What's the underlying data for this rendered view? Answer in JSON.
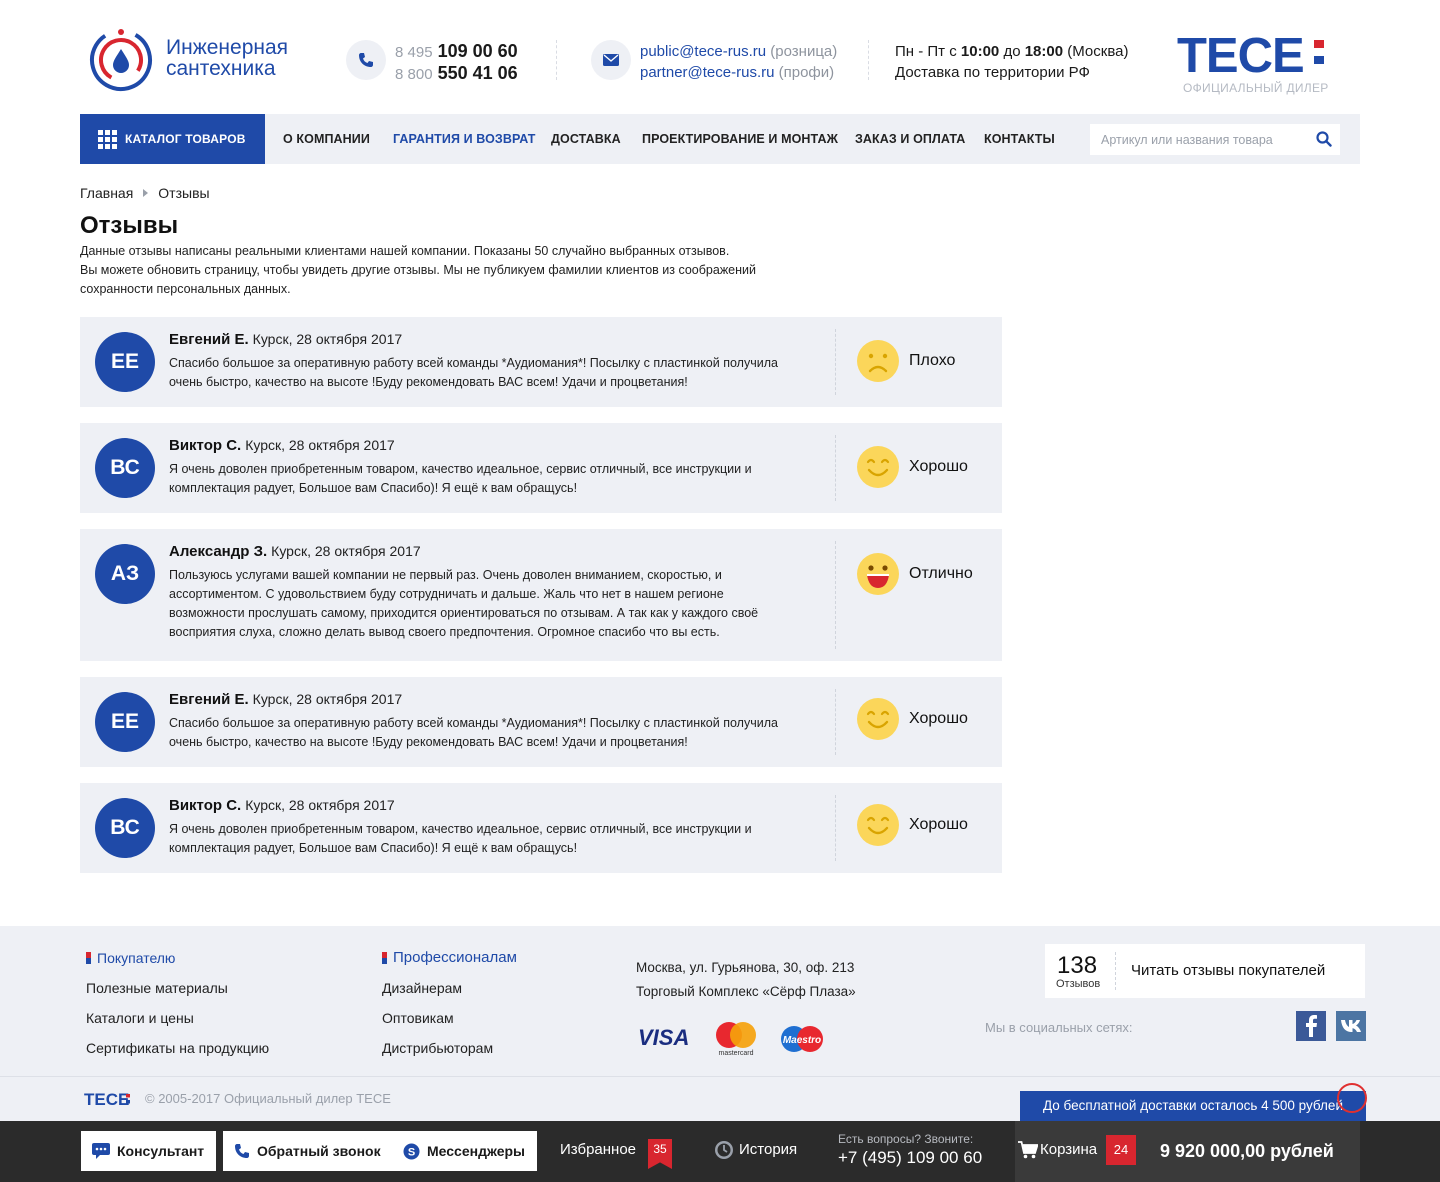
{
  "header": {
    "logo_line1": "Инженерная",
    "logo_line2": "сантехника",
    "phones": [
      {
        "prefix": "8 495",
        "number": "109 00 60"
      },
      {
        "prefix": "8 800",
        "number": "550 41 06"
      }
    ],
    "emails": [
      {
        "address": "public@tece-rus.ru",
        "note": "(розница)"
      },
      {
        "address": "partner@tece-rus.ru",
        "note": "(профи)"
      }
    ],
    "hours": {
      "days": "Пн - Пт с",
      "from": "10:00",
      "to_word": "до",
      "to": "18:00",
      "city": "(Москва)"
    },
    "delivery_area": "Доставка по территории РФ",
    "brand": "TECE",
    "brand_sub": "ОФИЦИАЛЬНЫЙ ДИЛЕР",
    "brand_color": "#1f4aa8",
    "accent_red": "#d8262f"
  },
  "nav": {
    "catalog_label": "КАТАЛОГ ТОВАРОВ",
    "items": [
      "О КОМПАНИИ",
      "ГАРАНТИЯ И ВОЗВРАТ",
      "ДОСТАВКА",
      "ПРОЕКТИРОВАНИЕ И МОНТАЖ",
      "ЗАКАЗ И ОПЛАТА",
      "КОНТАКТЫ"
    ],
    "active_item": "ГАРАНТИЯ И ВОЗВРАТ",
    "search_placeholder": "Артикул или названия товара",
    "search_value": ""
  },
  "breadcrumb": [
    "Главная",
    "Отзывы"
  ],
  "page": {
    "title": "Отзывы",
    "intro_line1": "Данные отзывы написаны реальными клиентами нашей компании. Показаны 50 случайно выбранных отзывов.",
    "intro_line2": "Вы можете обновить страницу, чтобы увидеть другие отзывы. Мы не публикуем фамилии клиентов из соображений сохранности персональных данных."
  },
  "reviews": [
    {
      "initials": "ЕЕ",
      "name": "Евгений Е.",
      "meta": "Курск, 28 октября 2017",
      "text": "Спасибо большое за оперативную работу всей команды *Аудиомания*! Посылку с пластинкой получила очень быстро, качество на высоте !Буду рекомендовать ВАС всем! Удачи и процветания!",
      "rating": "Плохо",
      "mood": "sad-face-icon"
    },
    {
      "initials": "ВС",
      "name": "Виктор С.",
      "meta": "Курск, 28 октября 2017",
      "text": "Я очень доволен приобретенным товаром, качество идеальное, сервис отличный, все инструкции и комплектация радует, Большое вам Спасибо)! Я ещё к вам обращусь!",
      "rating": "Хорошо",
      "mood": "smile-face-icon"
    },
    {
      "initials": "АЗ",
      "name": "Александр З.",
      "meta": "Курск, 28 октября 2017",
      "text": "Пользуюсь услугами вашей компании не первый раз. Очень доволен вниманием, скоростью, и ассортиментом. С удовольствием буду сотрудничать и дальше. Жаль что нет в нашем регионе возможности прослушать самому, приходится ориентироваться по отзывам. А так как у каждого своё восприятия слуха, сложно делать вывод своего предпочтения. Огромное спасибо что вы есть.",
      "rating": "Отлично",
      "mood": "laugh-face-icon"
    },
    {
      "initials": "ЕЕ",
      "name": "Евгений Е.",
      "meta": "Курск, 28 октября 2017",
      "text": "Спасибо большое за оперативную работу всей команды *Аудиомания*! Посылку с пластинкой получила очень быстро, качество на высоте !Буду рекомендовать ВАС всем! Удачи и процветания!",
      "rating": "Хорошо",
      "mood": "smile-face-icon"
    },
    {
      "initials": "ВС",
      "name": "Виктор С.",
      "meta": "Курск, 28 октября 2017",
      "text": "Я очень доволен приобретенным товаром, качество идеальное, сервис отличный, все инструкции и комплектация радует, Большое вам Спасибо)! Я ещё к вам обращусь!",
      "rating": "Хорошо",
      "mood": "smile-face-icon"
    }
  ],
  "footer": {
    "buyers_title": "Покупателю",
    "buyers_links": [
      "Полезные материалы",
      "Каталоги и цены",
      "Сертификаты на продукцию"
    ],
    "pros_title": "Профессионалам",
    "pros_links": [
      "Дизайнерам",
      "Оптовикам",
      "Дистрибьюторам"
    ],
    "address_line1": "Москва, ул. Гурьянова, 30, оф. 213",
    "address_line2": "Торговый Комплекс «Сёрф Плаза»",
    "payment_methods": [
      "VISA",
      "mastercard",
      "Maestro"
    ],
    "reviews_count": "138",
    "reviews_count_label": "Отзывов",
    "reviews_link": "Читать отзывы покупателей",
    "social_label": "Мы в социальных сетях:",
    "social": [
      "facebook-icon",
      "vk-icon"
    ],
    "copyright": "© 2005-2017 Официальный дилер TECE",
    "copyright_logo": "TECE"
  },
  "delivery_banner": "До бесплатной доставки осталось 4 500 рублей",
  "bottombar": {
    "consultant": "Консультант",
    "callback": "Обратный звонок",
    "messengers": "Мессенджеры",
    "favorites": "Избранное",
    "favorites_count": "35",
    "history": "История",
    "question": "Есть вопросы? Звоните:",
    "phone": "+7 (495) 109 00 60",
    "cart": "Корзина",
    "cart_count": "24",
    "cart_total": "9 920 000,00 рублей"
  }
}
